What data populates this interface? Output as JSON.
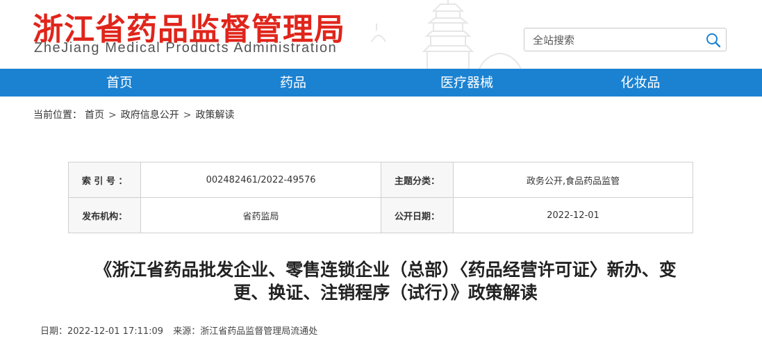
{
  "header": {
    "site_title_cn": "浙江省药品监督管理局",
    "site_title_en": "ZheJiang Medical Products Administration",
    "search_placeholder": "全站搜索"
  },
  "nav": [
    "首页",
    "药品",
    "医疗器械",
    "化妆品"
  ],
  "breadcrumb": {
    "prefix": "当前位置：",
    "items": [
      "首页",
      "政府信息公开",
      "政策解读"
    ],
    "separator": ">"
  },
  "meta": {
    "index_label": "索 引 号 ：",
    "index_value": "002482461/2022-49576",
    "topic_label": "主题分类：",
    "topic_value": "政务公开,食品药品监管",
    "issuer_label": "发布机构：",
    "issuer_value": "省药监局",
    "date_label": "公开日期：",
    "date_value": "2022-12-01"
  },
  "article": {
    "title_line1": "《浙江省药品批发企业、零售连锁企业（总部）〈药品经营许可证〉新办、变",
    "title_line2": "更、换证、注销程序（试行）》政策解读",
    "date": "日期：2022-12-01 17:11:09",
    "source": "来源：浙江省药品监督管理局流通处"
  }
}
